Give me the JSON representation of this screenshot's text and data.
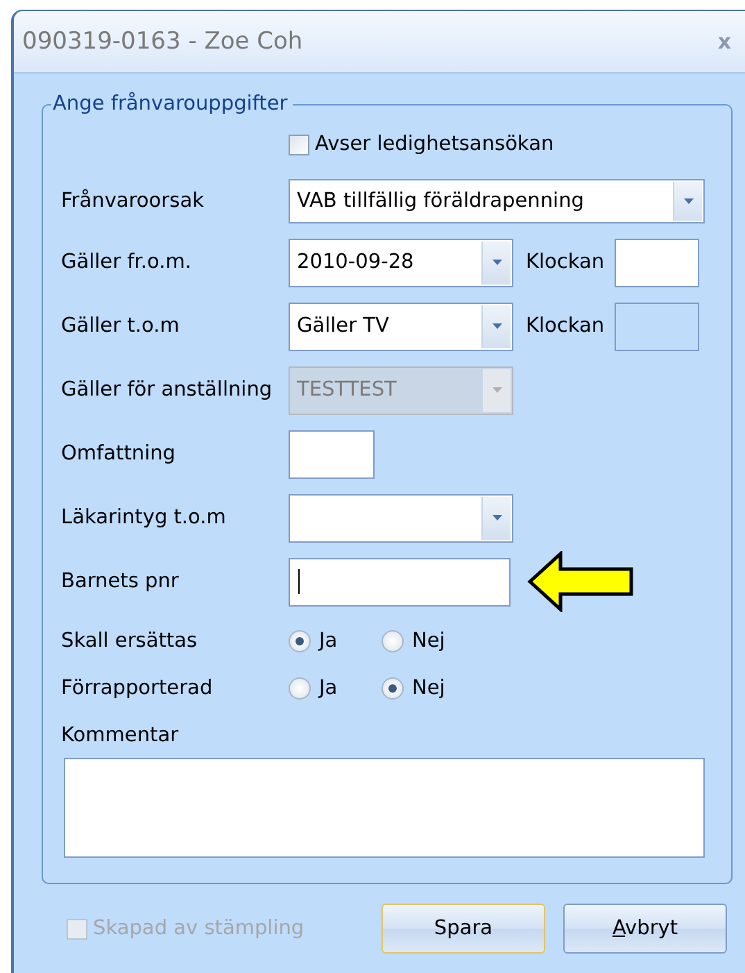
{
  "window": {
    "title": "090319-0163 - Zoe Coh",
    "close": "x"
  },
  "group": {
    "title": "Ange frånvarouppgifter",
    "fields": [
      {
        "kind": "checkbox",
        "label": "Avser ledighetsansökan",
        "checked": false
      },
      {
        "kind": "select",
        "label": "Frånvaroorsak",
        "value": "VAB tillfällig föräldrapenning",
        "disabled": false
      },
      {
        "kind": "date-time",
        "label": "Gäller fr.o.m.",
        "value": "2010-09-28",
        "disabled": false,
        "time_label": "Klockan",
        "time_disabled": false
      },
      {
        "kind": "date-time",
        "label": "Gäller t.o.m",
        "value": "Gäller TV",
        "disabled": false,
        "time_label": "Klockan",
        "time_disabled": true
      },
      {
        "kind": "combo",
        "label": "Gäller för anställning",
        "value": "TESTTEST",
        "disabled": true
      },
      {
        "kind": "short-text",
        "label": "Omfattning"
      },
      {
        "kind": "combo",
        "label": "Läkarintyg t.o.m",
        "disabled": false
      },
      {
        "kind": "text",
        "label": "Barnets pnr",
        "focused": true,
        "pointer_arrow": true
      },
      {
        "kind": "radio",
        "label": "Skall ersättas",
        "options": [
          {
            "label": "Ja",
            "selected": true
          },
          {
            "label": "Nej",
            "selected": false
          }
        ]
      },
      {
        "kind": "radio",
        "label": "Förrapporterad",
        "options": [
          {
            "label": "Ja",
            "selected": false
          },
          {
            "label": "Nej",
            "selected": true
          }
        ]
      },
      {
        "kind": "memo",
        "label": "Kommentar"
      }
    ]
  },
  "footer": {
    "checkbox": {
      "label": "Skapad av stämpling",
      "checked": false,
      "disabled": true
    },
    "buttons": [
      {
        "label": "Spara",
        "default": true
      },
      {
        "label": "Avbryt",
        "default": false
      }
    ]
  }
}
